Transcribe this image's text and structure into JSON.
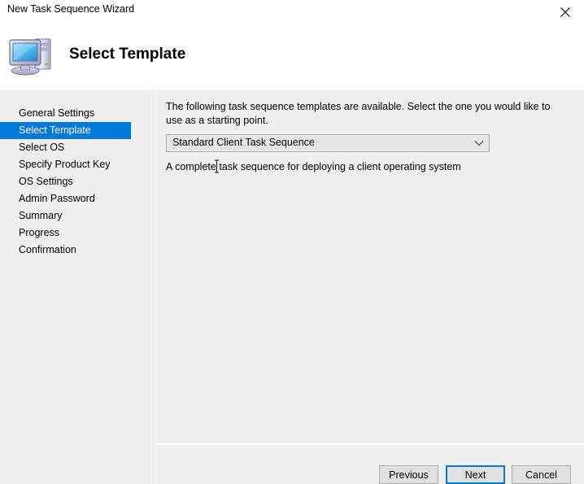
{
  "window": {
    "title": "New Task Sequence Wizard",
    "close_icon": "close-icon"
  },
  "header": {
    "title": "Select Template",
    "icon": "computer-monitor-icon"
  },
  "sidebar": {
    "items": [
      {
        "label": "General Settings",
        "selected": false
      },
      {
        "label": "Select Template",
        "selected": true
      },
      {
        "label": "Select OS",
        "selected": false
      },
      {
        "label": "Specify Product Key",
        "selected": false
      },
      {
        "label": "OS Settings",
        "selected": false
      },
      {
        "label": "Admin Password",
        "selected": false
      },
      {
        "label": "Summary",
        "selected": false
      },
      {
        "label": "Progress",
        "selected": false
      },
      {
        "label": "Confirmation",
        "selected": false
      }
    ]
  },
  "main": {
    "instruction": "The following task sequence templates are available.  Select the one you would like to use as a starting point.",
    "dropdown": {
      "selected": "Standard Client Task Sequence",
      "arrow_icon": "chevron-down-icon",
      "options": [
        "Standard Client Task Sequence"
      ]
    },
    "description": "A complete task sequence for deploying a client operating system"
  },
  "footer": {
    "previous_label": "Previous",
    "next_label": "Next",
    "cancel_label": "Cancel"
  },
  "colors": {
    "accent": "#0078d7",
    "body_background": "#efefef",
    "titlebar_background": "#ffffff",
    "button_face": "#e1e1e1",
    "button_border": "#adadad",
    "dropdown_face": "#e6e6e6"
  },
  "cursor": {
    "type": "text-ibeam-cursor"
  }
}
